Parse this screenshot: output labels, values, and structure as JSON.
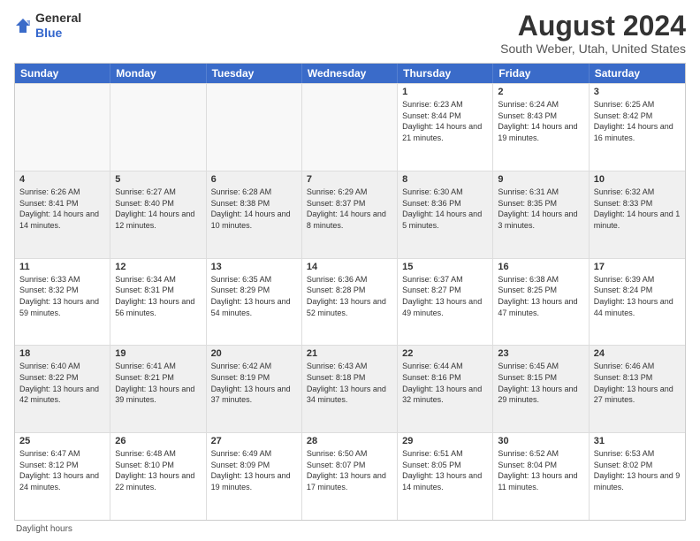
{
  "logo": {
    "general": "General",
    "blue": "Blue"
  },
  "title": "August 2024",
  "subtitle": "South Weber, Utah, United States",
  "weekdays": [
    "Sunday",
    "Monday",
    "Tuesday",
    "Wednesday",
    "Thursday",
    "Friday",
    "Saturday"
  ],
  "footer": "Daylight hours",
  "weeks": [
    [
      {
        "day": "",
        "sunrise": "",
        "sunset": "",
        "daylight": "",
        "empty": true
      },
      {
        "day": "",
        "sunrise": "",
        "sunset": "",
        "daylight": "",
        "empty": true
      },
      {
        "day": "",
        "sunrise": "",
        "sunset": "",
        "daylight": "",
        "empty": true
      },
      {
        "day": "",
        "sunrise": "",
        "sunset": "",
        "daylight": "",
        "empty": true
      },
      {
        "day": "1",
        "sunrise": "Sunrise: 6:23 AM",
        "sunset": "Sunset: 8:44 PM",
        "daylight": "Daylight: 14 hours and 21 minutes.",
        "empty": false
      },
      {
        "day": "2",
        "sunrise": "Sunrise: 6:24 AM",
        "sunset": "Sunset: 8:43 PM",
        "daylight": "Daylight: 14 hours and 19 minutes.",
        "empty": false
      },
      {
        "day": "3",
        "sunrise": "Sunrise: 6:25 AM",
        "sunset": "Sunset: 8:42 PM",
        "daylight": "Daylight: 14 hours and 16 minutes.",
        "empty": false
      }
    ],
    [
      {
        "day": "4",
        "sunrise": "Sunrise: 6:26 AM",
        "sunset": "Sunset: 8:41 PM",
        "daylight": "Daylight: 14 hours and 14 minutes.",
        "empty": false
      },
      {
        "day": "5",
        "sunrise": "Sunrise: 6:27 AM",
        "sunset": "Sunset: 8:40 PM",
        "daylight": "Daylight: 14 hours and 12 minutes.",
        "empty": false
      },
      {
        "day": "6",
        "sunrise": "Sunrise: 6:28 AM",
        "sunset": "Sunset: 8:38 PM",
        "daylight": "Daylight: 14 hours and 10 minutes.",
        "empty": false
      },
      {
        "day": "7",
        "sunrise": "Sunrise: 6:29 AM",
        "sunset": "Sunset: 8:37 PM",
        "daylight": "Daylight: 14 hours and 8 minutes.",
        "empty": false
      },
      {
        "day": "8",
        "sunrise": "Sunrise: 6:30 AM",
        "sunset": "Sunset: 8:36 PM",
        "daylight": "Daylight: 14 hours and 5 minutes.",
        "empty": false
      },
      {
        "day": "9",
        "sunrise": "Sunrise: 6:31 AM",
        "sunset": "Sunset: 8:35 PM",
        "daylight": "Daylight: 14 hours and 3 minutes.",
        "empty": false
      },
      {
        "day": "10",
        "sunrise": "Sunrise: 6:32 AM",
        "sunset": "Sunset: 8:33 PM",
        "daylight": "Daylight: 14 hours and 1 minute.",
        "empty": false
      }
    ],
    [
      {
        "day": "11",
        "sunrise": "Sunrise: 6:33 AM",
        "sunset": "Sunset: 8:32 PM",
        "daylight": "Daylight: 13 hours and 59 minutes.",
        "empty": false
      },
      {
        "day": "12",
        "sunrise": "Sunrise: 6:34 AM",
        "sunset": "Sunset: 8:31 PM",
        "daylight": "Daylight: 13 hours and 56 minutes.",
        "empty": false
      },
      {
        "day": "13",
        "sunrise": "Sunrise: 6:35 AM",
        "sunset": "Sunset: 8:29 PM",
        "daylight": "Daylight: 13 hours and 54 minutes.",
        "empty": false
      },
      {
        "day": "14",
        "sunrise": "Sunrise: 6:36 AM",
        "sunset": "Sunset: 8:28 PM",
        "daylight": "Daylight: 13 hours and 52 minutes.",
        "empty": false
      },
      {
        "day": "15",
        "sunrise": "Sunrise: 6:37 AM",
        "sunset": "Sunset: 8:27 PM",
        "daylight": "Daylight: 13 hours and 49 minutes.",
        "empty": false
      },
      {
        "day": "16",
        "sunrise": "Sunrise: 6:38 AM",
        "sunset": "Sunset: 8:25 PM",
        "daylight": "Daylight: 13 hours and 47 minutes.",
        "empty": false
      },
      {
        "day": "17",
        "sunrise": "Sunrise: 6:39 AM",
        "sunset": "Sunset: 8:24 PM",
        "daylight": "Daylight: 13 hours and 44 minutes.",
        "empty": false
      }
    ],
    [
      {
        "day": "18",
        "sunrise": "Sunrise: 6:40 AM",
        "sunset": "Sunset: 8:22 PM",
        "daylight": "Daylight: 13 hours and 42 minutes.",
        "empty": false
      },
      {
        "day": "19",
        "sunrise": "Sunrise: 6:41 AM",
        "sunset": "Sunset: 8:21 PM",
        "daylight": "Daylight: 13 hours and 39 minutes.",
        "empty": false
      },
      {
        "day": "20",
        "sunrise": "Sunrise: 6:42 AM",
        "sunset": "Sunset: 8:19 PM",
        "daylight": "Daylight: 13 hours and 37 minutes.",
        "empty": false
      },
      {
        "day": "21",
        "sunrise": "Sunrise: 6:43 AM",
        "sunset": "Sunset: 8:18 PM",
        "daylight": "Daylight: 13 hours and 34 minutes.",
        "empty": false
      },
      {
        "day": "22",
        "sunrise": "Sunrise: 6:44 AM",
        "sunset": "Sunset: 8:16 PM",
        "daylight": "Daylight: 13 hours and 32 minutes.",
        "empty": false
      },
      {
        "day": "23",
        "sunrise": "Sunrise: 6:45 AM",
        "sunset": "Sunset: 8:15 PM",
        "daylight": "Daylight: 13 hours and 29 minutes.",
        "empty": false
      },
      {
        "day": "24",
        "sunrise": "Sunrise: 6:46 AM",
        "sunset": "Sunset: 8:13 PM",
        "daylight": "Daylight: 13 hours and 27 minutes.",
        "empty": false
      }
    ],
    [
      {
        "day": "25",
        "sunrise": "Sunrise: 6:47 AM",
        "sunset": "Sunset: 8:12 PM",
        "daylight": "Daylight: 13 hours and 24 minutes.",
        "empty": false
      },
      {
        "day": "26",
        "sunrise": "Sunrise: 6:48 AM",
        "sunset": "Sunset: 8:10 PM",
        "daylight": "Daylight: 13 hours and 22 minutes.",
        "empty": false
      },
      {
        "day": "27",
        "sunrise": "Sunrise: 6:49 AM",
        "sunset": "Sunset: 8:09 PM",
        "daylight": "Daylight: 13 hours and 19 minutes.",
        "empty": false
      },
      {
        "day": "28",
        "sunrise": "Sunrise: 6:50 AM",
        "sunset": "Sunset: 8:07 PM",
        "daylight": "Daylight: 13 hours and 17 minutes.",
        "empty": false
      },
      {
        "day": "29",
        "sunrise": "Sunrise: 6:51 AM",
        "sunset": "Sunset: 8:05 PM",
        "daylight": "Daylight: 13 hours and 14 minutes.",
        "empty": false
      },
      {
        "day": "30",
        "sunrise": "Sunrise: 6:52 AM",
        "sunset": "Sunset: 8:04 PM",
        "daylight": "Daylight: 13 hours and 11 minutes.",
        "empty": false
      },
      {
        "day": "31",
        "sunrise": "Sunrise: 6:53 AM",
        "sunset": "Sunset: 8:02 PM",
        "daylight": "Daylight: 13 hours and 9 minutes.",
        "empty": false
      }
    ]
  ]
}
